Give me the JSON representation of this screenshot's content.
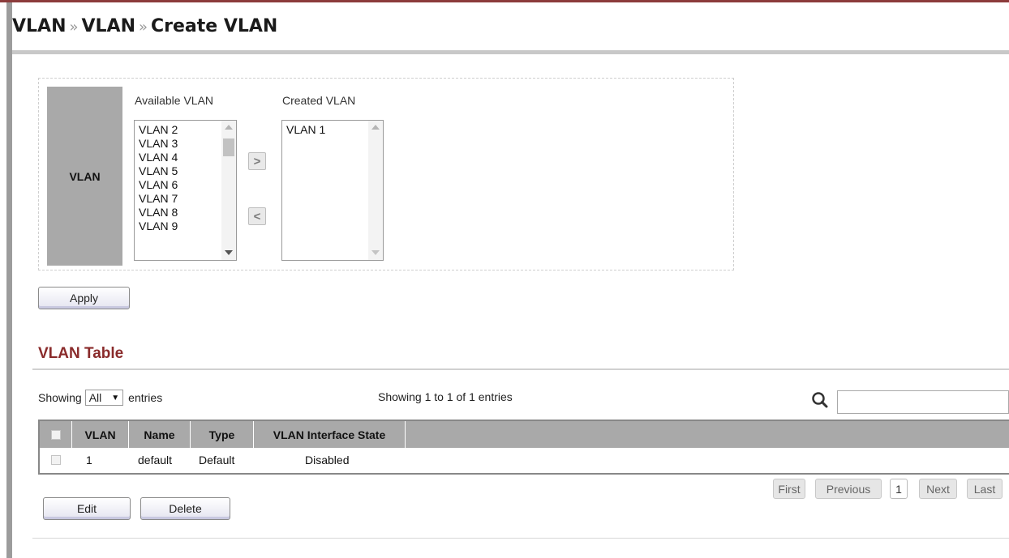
{
  "breadcrumb": [
    "VLAN",
    "VLAN",
    "Create VLAN"
  ],
  "breadcrumb_separator": "»",
  "form": {
    "field_label": "VLAN",
    "available_title": "Available VLAN",
    "created_title": "Created VLAN",
    "available_items": [
      "VLAN 2",
      "VLAN 3",
      "VLAN 4",
      "VLAN 5",
      "VLAN 6",
      "VLAN 7",
      "VLAN 8",
      "VLAN 9"
    ],
    "created_items": [
      "VLAN 1"
    ],
    "add_icon": ">",
    "remove_icon": "<",
    "apply_label": "Apply"
  },
  "table_section": {
    "title": "VLAN Table",
    "showing_prefix": "Showing",
    "entries_select_value": "All",
    "showing_suffix": "entries",
    "info": "Showing 1 to 1 of 1 entries",
    "search_placeholder": "",
    "columns": [
      "VLAN",
      "Name",
      "Type",
      "VLAN Interface State"
    ],
    "rows": [
      {
        "vlan": "1",
        "name": "default",
        "type": "Default",
        "state": "Disabled"
      }
    ],
    "pager": {
      "first": "First",
      "previous": "Previous",
      "current": "1",
      "next": "Next",
      "last": "Last"
    },
    "edit_label": "Edit",
    "delete_label": "Delete"
  },
  "colors": {
    "accent_title": "#8a2b2b",
    "header_bar": "#a9a9a9"
  }
}
